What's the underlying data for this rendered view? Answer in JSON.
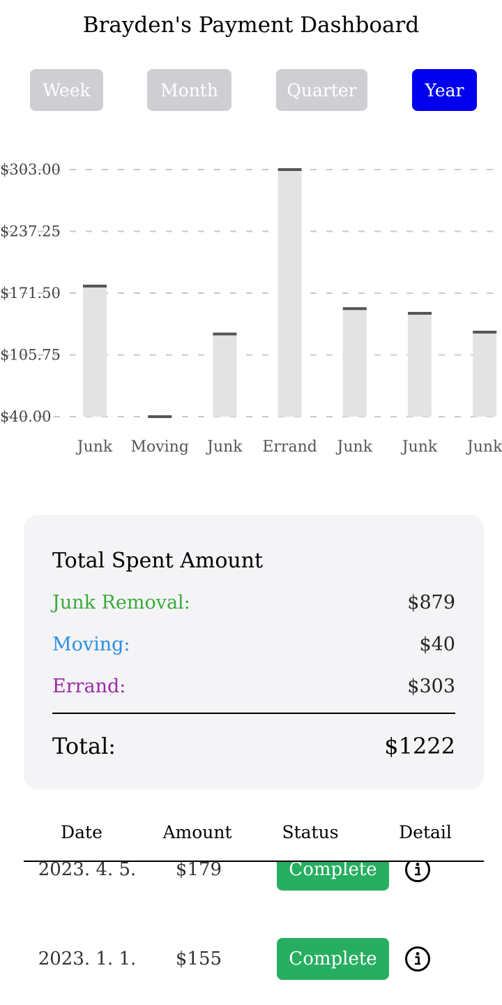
{
  "header": {
    "title": "Brayden's Payment Dashboard"
  },
  "periods": [
    {
      "label": "Week",
      "active": false
    },
    {
      "label": "Month",
      "active": false
    },
    {
      "label": "Quarter",
      "active": false
    },
    {
      "label": "Year",
      "active": true
    }
  ],
  "colors": {
    "accent": "#0000ee",
    "inactive": "#cfcfd3",
    "junk": "#3aaa3a",
    "moving": "#2b8fe0",
    "errand": "#9b2aa6",
    "complete": "#27ae60",
    "bar": "#e3e3e3",
    "bar_cap": "#555555"
  },
  "chart_data": {
    "type": "bar",
    "categories": [
      "Junk",
      "Moving",
      "Junk",
      "Errand",
      "Junk",
      "Junk",
      "Junk"
    ],
    "values": [
      179,
      40,
      128,
      303,
      155,
      150,
      130
    ],
    "ylim": [
      40,
      303
    ],
    "yticks": [
      "$303.00",
      "$237.25",
      "$171.50",
      "$105.75",
      "$40.00"
    ],
    "grid": true
  },
  "summary": {
    "title": "Total Spent Amount",
    "rows": [
      {
        "label": "Junk Removal:",
        "value": "$879"
      },
      {
        "label": "Moving:",
        "value": "$40"
      },
      {
        "label": "Errand:",
        "value": "$303"
      }
    ],
    "total_label": "Total:",
    "total_value": "$1222"
  },
  "table": {
    "headers": [
      "Date",
      "Amount",
      "Status",
      "Detail"
    ],
    "rows": [
      {
        "date": "2023. 4. 5.",
        "amount": "$179",
        "status": "Complete",
        "detail_icon": "info-icon"
      },
      {
        "date": "2023. 1. 1.",
        "amount": "$155",
        "status": "Complete",
        "detail_icon": "info-icon"
      }
    ]
  }
}
